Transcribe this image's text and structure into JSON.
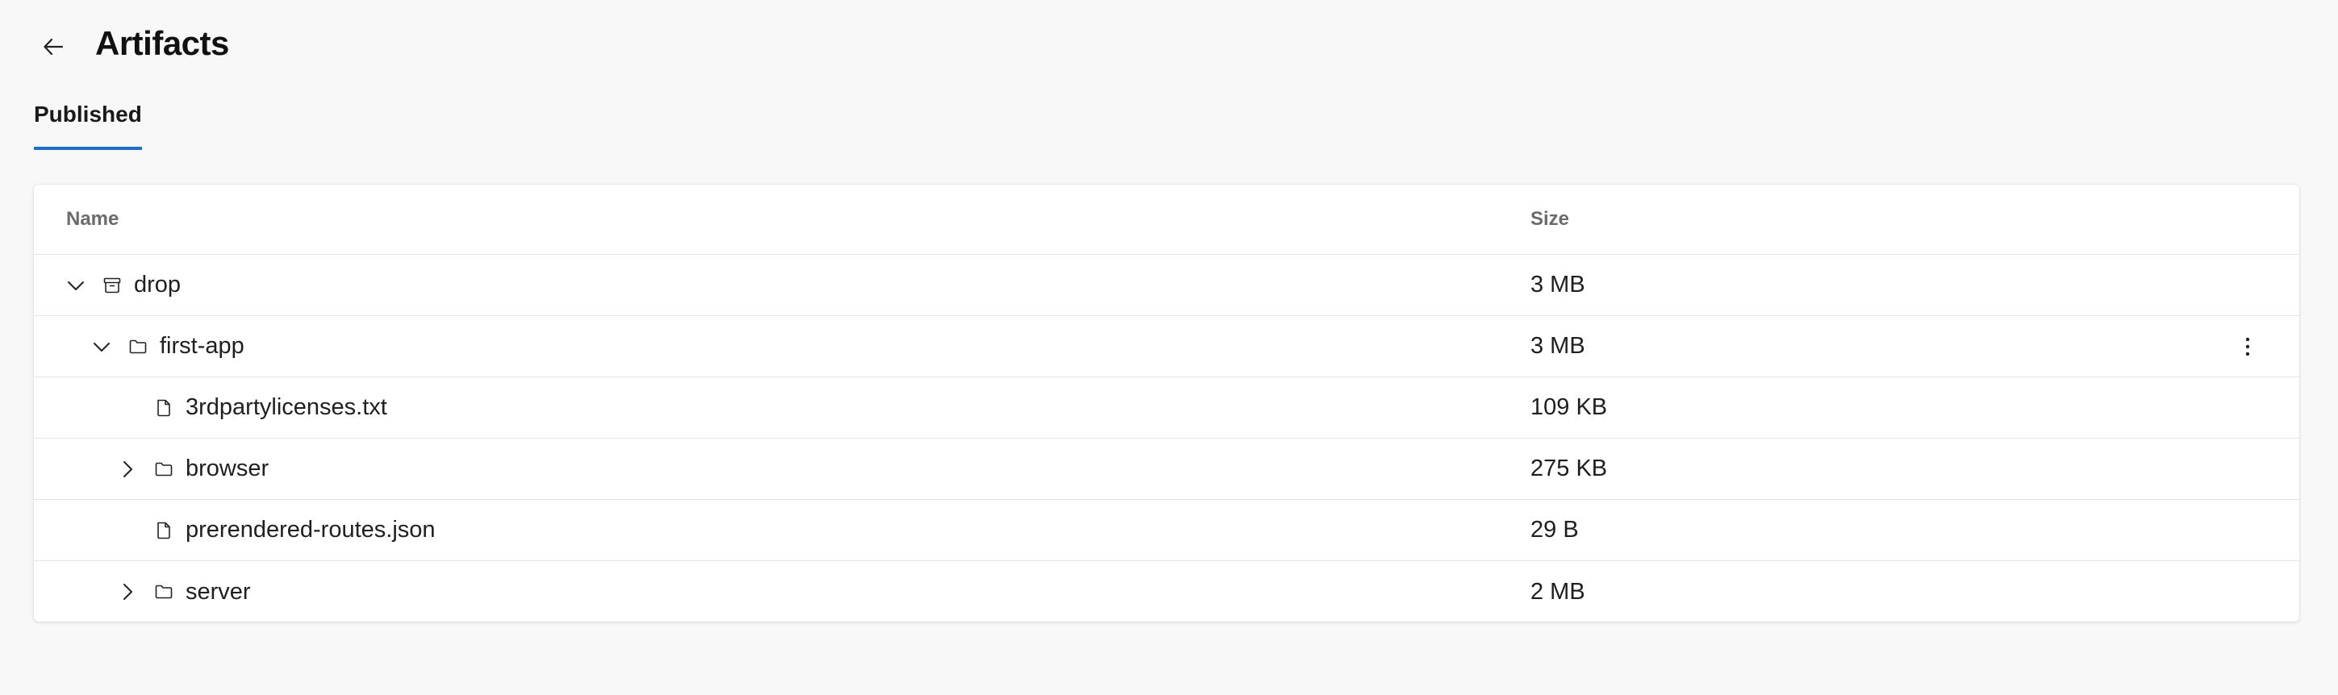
{
  "page": {
    "title": "Artifacts"
  },
  "tabs": [
    {
      "label": "Published",
      "active": true
    }
  ],
  "table": {
    "columns": {
      "name": "Name",
      "size": "Size"
    },
    "rows": [
      {
        "name": "drop",
        "size": "3 MB",
        "type": "artifact",
        "expander": "expanded"
      },
      {
        "name": "first-app",
        "size": "3 MB",
        "type": "folder",
        "expander": "expanded",
        "has_more_menu": true
      },
      {
        "name": "3rdpartylicenses.txt",
        "size": "109 KB",
        "type": "file",
        "expander": "none"
      },
      {
        "name": "browser",
        "size": "275 KB",
        "type": "folder",
        "expander": "collapsed"
      },
      {
        "name": "prerendered-routes.json",
        "size": "29 B",
        "type": "file",
        "expander": "none"
      },
      {
        "name": "server",
        "size": "2 MB",
        "type": "folder",
        "expander": "collapsed"
      }
    ]
  },
  "colors": {
    "accent": "#1e6ed6",
    "background": "#f8f8f8",
    "panel": "#ffffff",
    "header_text": "#6b6b6b"
  }
}
